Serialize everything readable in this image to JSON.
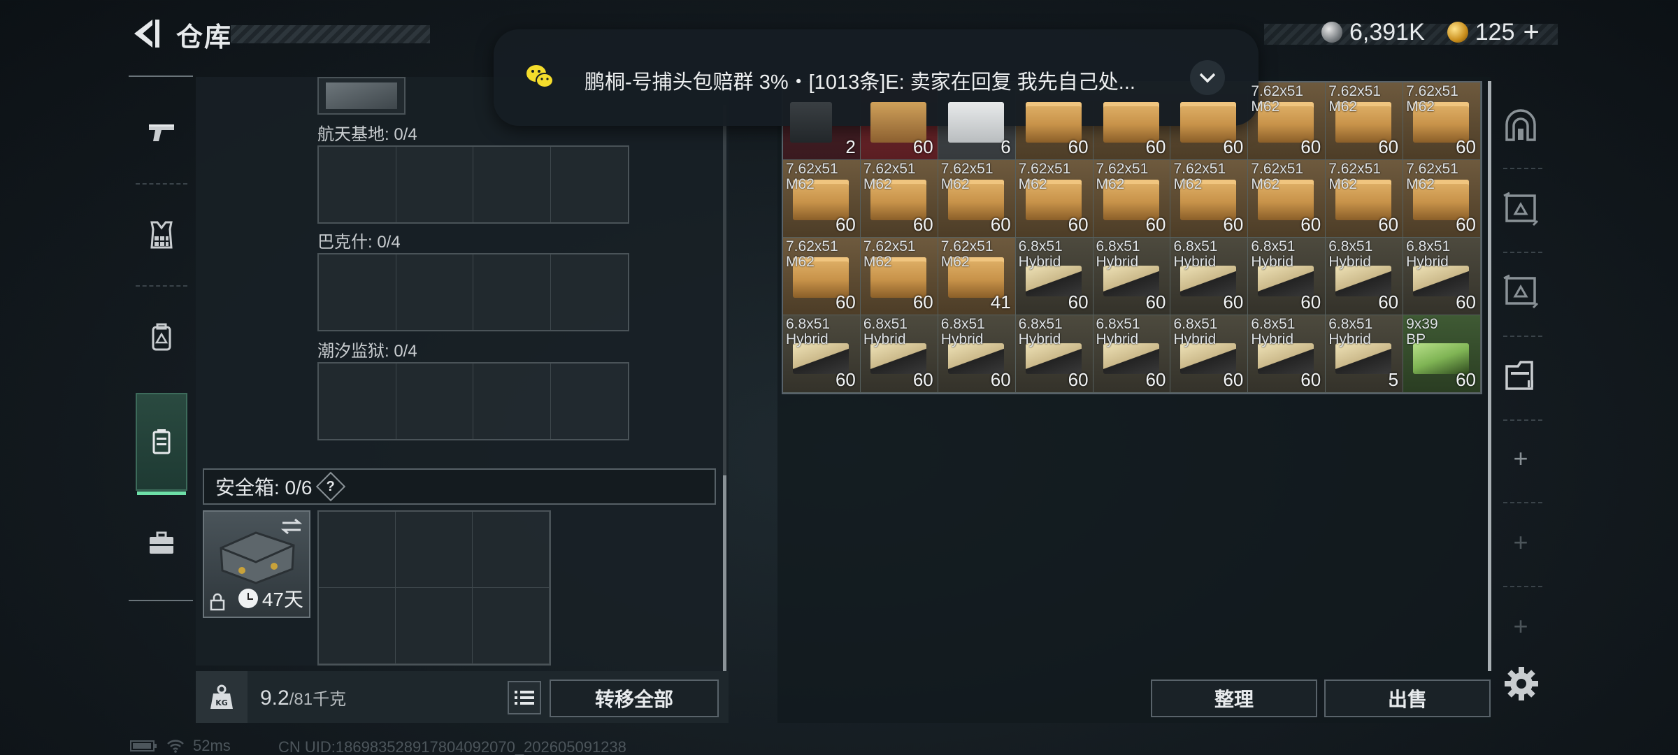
{
  "header": {
    "title": "仓库"
  },
  "currency": {
    "silver": "6,391K",
    "gold": "125"
  },
  "notification": {
    "text": "鹏桐-号捕头包赔群 3%・[1013条]E: 卖家在回复  我先自己处..."
  },
  "left_tabs": [
    {
      "name": "weapons-tab",
      "icon": "pistol-icon"
    },
    {
      "name": "vest-tab",
      "icon": "vest-icon"
    },
    {
      "name": "backpack-tab",
      "icon": "backpack-icon"
    },
    {
      "name": "container-tab",
      "icon": "container-icon",
      "active": true
    },
    {
      "name": "briefcase-tab",
      "icon": "briefcase-icon"
    }
  ],
  "storage": {
    "grids": [
      {
        "label": "航天基地: 0/4"
      },
      {
        "label": "巴克什: 0/4"
      },
      {
        "label": "潮汐监狱: 0/4"
      }
    ],
    "safebox_label": "安全箱: 0/6",
    "safebox_help": "?",
    "safebox_days": "47天"
  },
  "weight": {
    "current": "9.2",
    "max": "/81千克"
  },
  "buttons": {
    "transfer_all": "转移全部",
    "organize": "整理",
    "sell": "出售"
  },
  "inventory": [
    {
      "type": "case",
      "line1": "",
      "line2": "",
      "qty": "2"
    },
    {
      "type": "red",
      "line1": "",
      "line2": "",
      "qty": "60"
    },
    {
      "type": "white",
      "line1": "",
      "line2": "",
      "qty": "6"
    },
    {
      "type": "762",
      "line1": "",
      "line2": "",
      "qty": "60"
    },
    {
      "type": "762",
      "line1": "",
      "line2": "",
      "qty": "60"
    },
    {
      "type": "762",
      "line1": "",
      "line2": "",
      "qty": "60"
    },
    {
      "type": "762",
      "line1": "7.62x51",
      "line2": "M62",
      "qty": "60"
    },
    {
      "type": "762",
      "line1": "7.62x51",
      "line2": "M62",
      "qty": "60"
    },
    {
      "type": "762",
      "line1": "7.62x51",
      "line2": "M62",
      "qty": "60"
    },
    {
      "type": "762",
      "line1": "7.62x51",
      "line2": "M62",
      "qty": "60"
    },
    {
      "type": "762",
      "line1": "7.62x51",
      "line2": "M62",
      "qty": "60"
    },
    {
      "type": "762",
      "line1": "7.62x51",
      "line2": "M62",
      "qty": "60"
    },
    {
      "type": "762",
      "line1": "7.62x51",
      "line2": "M62",
      "qty": "60"
    },
    {
      "type": "762",
      "line1": "7.62x51",
      "line2": "M62",
      "qty": "60"
    },
    {
      "type": "762",
      "line1": "7.62x51",
      "line2": "M62",
      "qty": "60"
    },
    {
      "type": "762",
      "line1": "7.62x51",
      "line2": "M62",
      "qty": "60"
    },
    {
      "type": "762",
      "line1": "7.62x51",
      "line2": "M62",
      "qty": "60"
    },
    {
      "type": "762",
      "line1": "7.62x51",
      "line2": "M62",
      "qty": "60"
    },
    {
      "type": "762",
      "line1": "7.62x51",
      "line2": "M62",
      "qty": "60"
    },
    {
      "type": "762",
      "line1": "7.62x51",
      "line2": "M62",
      "qty": "60"
    },
    {
      "type": "762",
      "line1": "7.62x51",
      "line2": "M62",
      "qty": "41"
    },
    {
      "type": "68",
      "line1": "6.8x51",
      "line2": "Hybrid",
      "qty": "60"
    },
    {
      "type": "68",
      "line1": "6.8x51",
      "line2": "Hybrid",
      "qty": "60"
    },
    {
      "type": "68",
      "line1": "6.8x51",
      "line2": "Hybrid",
      "qty": "60"
    },
    {
      "type": "68",
      "line1": "6.8x51",
      "line2": "Hybrid",
      "qty": "60"
    },
    {
      "type": "68",
      "line1": "6.8x51",
      "line2": "Hybrid",
      "qty": "60"
    },
    {
      "type": "68",
      "line1": "6.8x51",
      "line2": "Hybrid",
      "qty": "60"
    },
    {
      "type": "68",
      "line1": "6.8x51",
      "line2": "Hybrid",
      "qty": "60"
    },
    {
      "type": "68",
      "line1": "6.8x51",
      "line2": "Hybrid",
      "qty": "60"
    },
    {
      "type": "68",
      "line1": "6.8x51",
      "line2": "Hybrid",
      "qty": "60"
    },
    {
      "type": "68",
      "line1": "6.8x51",
      "line2": "Hybrid",
      "qty": "60"
    },
    {
      "type": "68",
      "line1": "6.8x51",
      "line2": "Hybrid",
      "qty": "60"
    },
    {
      "type": "68",
      "line1": "6.8x51",
      "line2": "Hybrid",
      "qty": "60"
    },
    {
      "type": "68",
      "line1": "6.8x51",
      "line2": "Hybrid",
      "qty": "60"
    },
    {
      "type": "68",
      "line1": "6.8x51",
      "line2": "Hybrid",
      "qty": "5"
    },
    {
      "type": "939",
      "line1": "9x39",
      "line2": "BP",
      "qty": "60"
    }
  ],
  "status": {
    "latency": "52ms",
    "uid": "CN UID:18698352891780409​2070_202605091238"
  },
  "colors": {
    "active_tab_accent": "#6ee0a8",
    "ammo_762": "#c8934a",
    "ammo_68": "#cbb98a",
    "ammo_939": "#7fb454"
  }
}
